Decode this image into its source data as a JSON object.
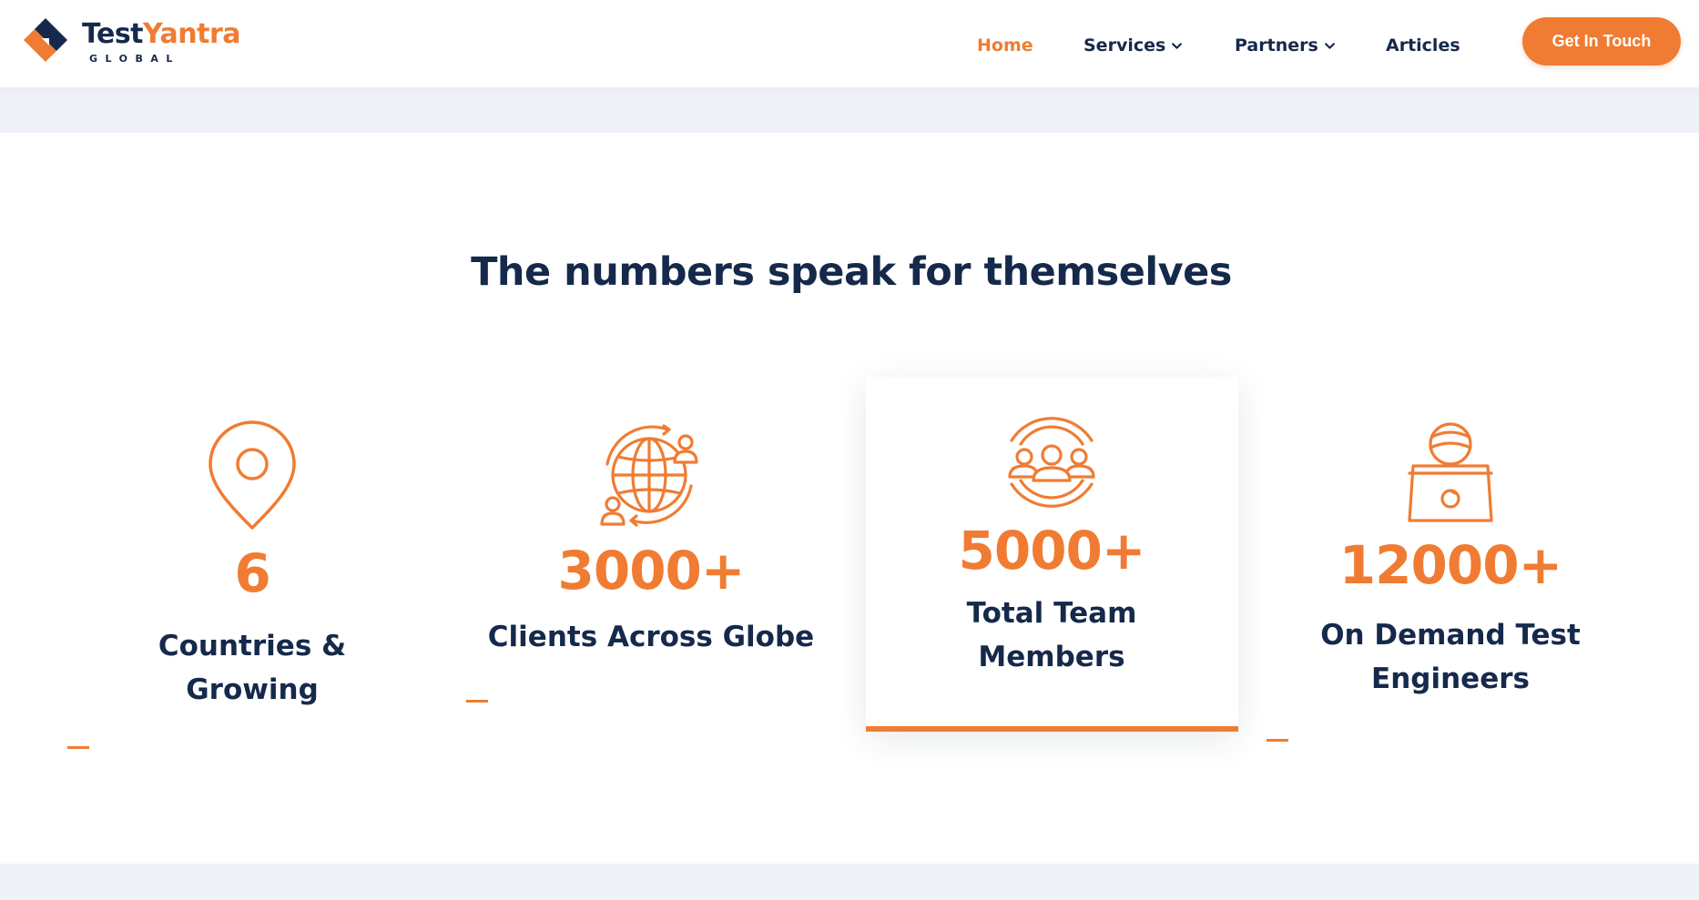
{
  "brand": {
    "name_part1": "Test",
    "name_part2": "Yantra",
    "subtitle": "GLOBAL",
    "logo_icon": "testyantra-logo-mark",
    "accent_color": "#f07c33",
    "dark_color": "#15294b"
  },
  "nav": {
    "items": [
      {
        "label": "Home",
        "active": true
      },
      {
        "label": "Services",
        "dropdown": true,
        "icon": "chevron-down-icon"
      },
      {
        "label": "Partners",
        "dropdown": true,
        "icon": "chevron-down-icon"
      },
      {
        "label": "Articles"
      }
    ],
    "cta_label": "Get In Touch"
  },
  "section": {
    "title": "The numbers speak for themselves"
  },
  "stats": [
    {
      "icon": "location-pin-icon",
      "value": "6",
      "label_line1": "Countries &",
      "label_line2": "Growing"
    },
    {
      "icon": "globe-clients-icon",
      "value": "3000+",
      "label_line1": "Clients Across Globe",
      "label_line2": ""
    },
    {
      "icon": "team-group-icon",
      "value": "5000+",
      "label_line1": "Total Team",
      "label_line2": "Members",
      "highlighted": true
    },
    {
      "icon": "engineer-laptop-icon",
      "value": "12000+",
      "label_line1": "On Demand Test",
      "label_line2": "Engineers"
    }
  ]
}
